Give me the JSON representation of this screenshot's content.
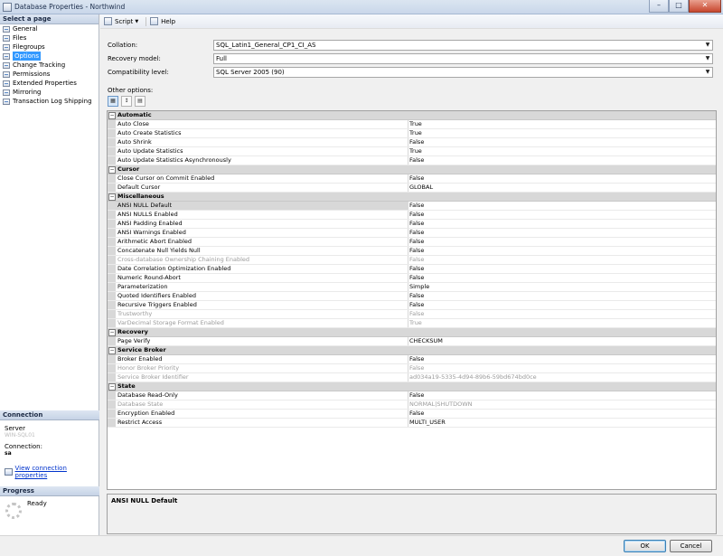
{
  "window": {
    "title": "Database Properties - Northwind",
    "minimize": "–",
    "maximize": "□",
    "close": "✕"
  },
  "left": {
    "select_page_header": "Select a page",
    "pages": [
      {
        "label": "General"
      },
      {
        "label": "Files"
      },
      {
        "label": "Filegroups"
      },
      {
        "label": "Options"
      },
      {
        "label": "Change Tracking"
      },
      {
        "label": "Permissions"
      },
      {
        "label": "Extended Properties"
      },
      {
        "label": "Mirroring"
      },
      {
        "label": "Transaction Log Shipping"
      }
    ],
    "selected_page": "Options",
    "connection_header": "Connection",
    "server_label": "Server",
    "server_value": "WIN-SQL01",
    "connection_label": "Connection:",
    "connection_value": "sa",
    "view_connection_link": "View connection properties",
    "progress_header": "Progress",
    "progress_status": "Ready"
  },
  "toolbar": {
    "script_label": "Script",
    "script_caret": "▼",
    "help_label": "Help"
  },
  "fields": {
    "collation_label": "Collation:",
    "collation_value": "SQL_Latin1_General_CP1_CI_AS",
    "recovery_label": "Recovery model:",
    "recovery_value": "Full",
    "compat_label": "Compatibility level:",
    "compat_value": "SQL Server 2005 (90)",
    "dropdown_arrow": "▼"
  },
  "other_options_label": "Other options:",
  "grid_tools": {
    "categorized": "▦",
    "alphabetical": "↕",
    "property_pages": "▤"
  },
  "grid": [
    {
      "category": "Automatic",
      "rows": [
        {
          "name": "Auto Close",
          "value": "True"
        },
        {
          "name": "Auto Create Statistics",
          "value": "True"
        },
        {
          "name": "Auto Shrink",
          "value": "False"
        },
        {
          "name": "Auto Update Statistics",
          "value": "True"
        },
        {
          "name": "Auto Update Statistics Asynchronously",
          "value": "False"
        }
      ]
    },
    {
      "category": "Cursor",
      "rows": [
        {
          "name": "Close Cursor on Commit Enabled",
          "value": "False"
        },
        {
          "name": "Default Cursor",
          "value": "GLOBAL"
        }
      ]
    },
    {
      "category": "Miscellaneous",
      "rows": [
        {
          "name": "ANSI NULL Default",
          "value": "False",
          "selected": true
        },
        {
          "name": "ANSI NULLS Enabled",
          "value": "False"
        },
        {
          "name": "ANSI Padding Enabled",
          "value": "False"
        },
        {
          "name": "ANSI Warnings Enabled",
          "value": "False"
        },
        {
          "name": "Arithmetic Abort Enabled",
          "value": "False"
        },
        {
          "name": "Concatenate Null Yields Null",
          "value": "False"
        },
        {
          "name": "Cross-database Ownership Chaining Enabled",
          "value": "False",
          "readonly": true
        },
        {
          "name": "Date Correlation Optimization Enabled",
          "value": "False"
        },
        {
          "name": "Numeric Round-Abort",
          "value": "False"
        },
        {
          "name": "Parameterization",
          "value": "Simple"
        },
        {
          "name": "Quoted Identifiers Enabled",
          "value": "False"
        },
        {
          "name": "Recursive Triggers Enabled",
          "value": "False"
        },
        {
          "name": "Trustworthy",
          "value": "False",
          "readonly": true
        },
        {
          "name": "VarDecimal Storage Format Enabled",
          "value": "True",
          "readonly": true
        }
      ]
    },
    {
      "category": "Recovery",
      "rows": [
        {
          "name": "Page Verify",
          "value": "CHECKSUM"
        }
      ]
    },
    {
      "category": "Service Broker",
      "rows": [
        {
          "name": "Broker Enabled",
          "value": "False"
        },
        {
          "name": "Honor Broker Priority",
          "value": "False",
          "readonly": true
        },
        {
          "name": "Service Broker Identifier",
          "value": "ad034a19-5335-4d94-89b6-59bd674bd0ce",
          "readonly": true
        }
      ]
    },
    {
      "category": "State",
      "rows": [
        {
          "name": "Database Read-Only",
          "value": "False"
        },
        {
          "name": "Database State",
          "value": "NORMAL|SHUTDOWN",
          "readonly": true
        },
        {
          "name": "Encryption Enabled",
          "value": "False"
        },
        {
          "name": "Restrict Access",
          "value": "MULTI_USER"
        }
      ]
    }
  ],
  "description": {
    "title": "ANSI NULL Default"
  },
  "buttons": {
    "ok": "OK",
    "cancel": "Cancel"
  }
}
